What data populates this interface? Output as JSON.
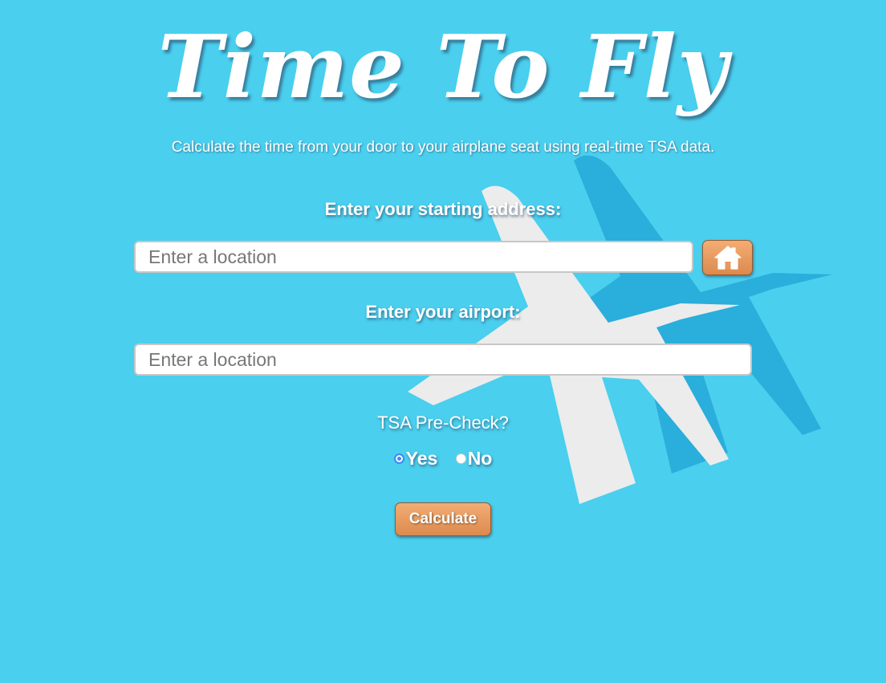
{
  "app": {
    "title": "Time To Fly",
    "subtitle": "Calculate the time from your door to your airplane seat using real-time TSA data."
  },
  "form": {
    "start_label": "Enter your starting address:",
    "start_placeholder": "Enter a location",
    "home_button_icon": "home-icon",
    "airport_label": "Enter your airport:",
    "airport_placeholder": "Enter a location",
    "tsa_label": "TSA Pre-Check?",
    "tsa_options": [
      {
        "label": "Yes",
        "checked": true
      },
      {
        "label": "No",
        "checked": false
      }
    ],
    "calculate_label": "Calculate"
  },
  "colors": {
    "background": "#4acfee",
    "button": "#e8985d",
    "plane_front": "#ececec",
    "plane_shadow": "#2aaedb",
    "radio_checked": "#3b8cf5"
  },
  "decorations": [
    "airplane-graphic",
    "airplane-shadow-graphic"
  ]
}
